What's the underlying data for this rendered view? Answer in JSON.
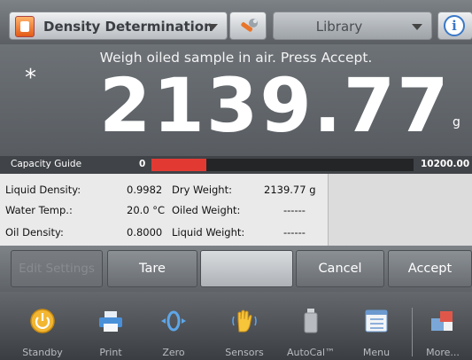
{
  "header": {
    "app_title": "Density Determination",
    "library_label": "Library",
    "info_symbol": "i"
  },
  "display": {
    "instruction": "Weigh oiled sample in air. Press Accept.",
    "stability_mark": "*",
    "weight": "2139.77",
    "unit": "g"
  },
  "capacity": {
    "label": "Capacity Guide",
    "min": "0",
    "max": "10200.00",
    "fill_fraction": 0.21
  },
  "results": {
    "liquid_density_label": "Liquid Density:",
    "liquid_density_value": "0.9982",
    "water_temp_label": "Water Temp.:",
    "water_temp_value": "20.0 °C",
    "oil_density_label": "Oil Density:",
    "oil_density_value": "0.8000",
    "dry_weight_label": "Dry Weight:",
    "dry_weight_value": "2139.77 g",
    "oiled_weight_label": "Oiled Weight:",
    "oiled_weight_value": "------",
    "liquid_weight_label": "Liquid Weight:",
    "liquid_weight_value": "------"
  },
  "actions": {
    "edit_settings": "Edit Settings",
    "tare": "Tare",
    "cancel": "Cancel",
    "accept": "Accept"
  },
  "footer": {
    "items": [
      "Standby",
      "Print",
      "Zero",
      "Sensors",
      "AutoCal™",
      "Menu",
      "More..."
    ]
  },
  "colors": {
    "capacity_fill": "#e23a33",
    "app_icon": "#e35b17",
    "info_ring": "#3a78c8"
  }
}
